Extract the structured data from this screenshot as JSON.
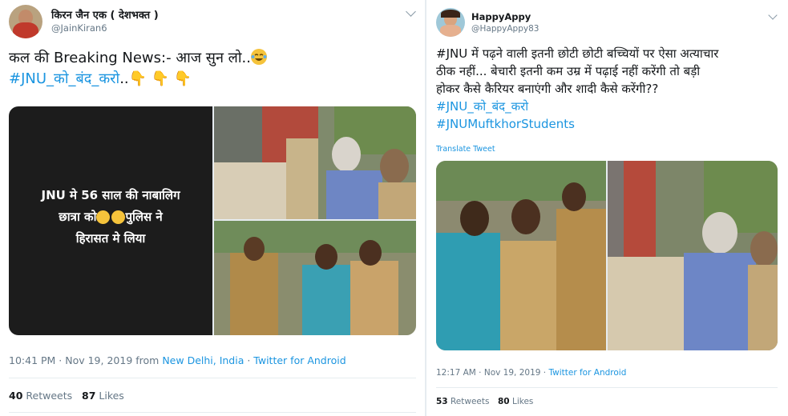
{
  "tweet1": {
    "display_name": "किरन जैन एक ( देशभक्त )",
    "handle": "@JainKiran6",
    "text_line1": "कल की Breaking News:- आज सुन लो..",
    "hashtag": "#JNU_को_बंद_करो",
    "hashtag_suffix": "..",
    "hands": "👇 👇 👇",
    "image_caption": "JNU मे 56 साल की नाबालिग छात्रा को😛😛पुलिस ने हिरासत मे लिया",
    "caption_line1": "JNU मे 56 साल की नाबालिग",
    "caption_line2a": "छात्रा को",
    "caption_line2b": "पुलिस ने",
    "caption_line3": "हिरासत मे लिया",
    "time": "10:41 PM · Nov 19, 2019 from",
    "location": "New Delhi, India",
    "dot": " · ",
    "source": "Twitter for Android",
    "retweets_count": "40",
    "retweets_label": "Retweets",
    "likes_count": "87",
    "likes_label": "Likes"
  },
  "tweet2": {
    "display_name": "HappyAppy",
    "handle": "@HappyAppy83",
    "text_line1": "#JNU में पढ़ने वाली इतनी छोटी छोटी बच्चियों पर ऐसा अत्याचार",
    "text_line2": "ठीक नहीं... बेचारी इतनी कम उम्र में पढ़ाई नहीं करेंगी तो बड़ी",
    "text_line3": "होकर कैसे कैरियर बनाएंगी और शादी कैसे करेंगी??",
    "hashtag1": "#JNU_को_बंद_करो",
    "hashtag2": "#JNUMuftkhorStudents",
    "translate": "Translate Tweet",
    "time": "12:17 AM · Nov 19, 2019 · ",
    "source": "Twitter for Android",
    "retweets_count": "53",
    "retweets_label": "Retweets",
    "likes_count": "80",
    "likes_label": "Likes"
  },
  "colors": {
    "link": "#1b95e0",
    "secondary_text": "#657786",
    "divider": "#e6ecf0",
    "caption_bg": "#1c1c1c"
  },
  "icons": [
    "chevron-down-icon",
    "tears-of-joy-emoji",
    "pointing-down-emoji",
    "tongue-emoji"
  ]
}
